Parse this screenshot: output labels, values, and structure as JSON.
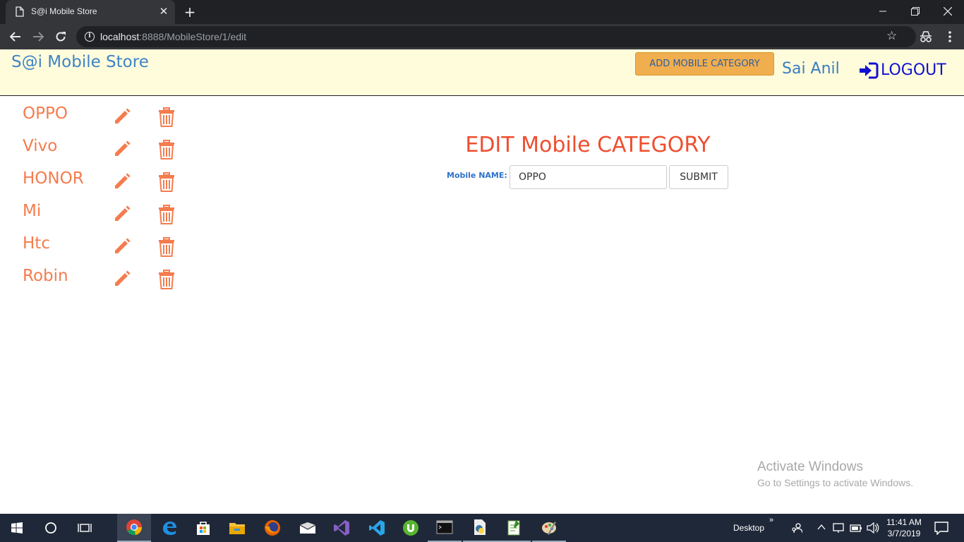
{
  "browser": {
    "tab_title": "S@i Mobile Store",
    "tab_close": "✕",
    "new_tab": "+",
    "url_host": "localhost",
    "url_rest": ":8888/MobileStore/1/edit"
  },
  "header": {
    "brand": "S@i Mobile Store",
    "add_button": "ADD MOBILE CATEGORY",
    "user_name": "Sai Anil",
    "logout_label": "LOGOUT"
  },
  "categories": [
    {
      "name": "OPPO"
    },
    {
      "name": "Vivo"
    },
    {
      "name": "HONOR"
    },
    {
      "name": "Mi"
    },
    {
      "name": "Htc"
    },
    {
      "name": "Robin"
    }
  ],
  "edit_form": {
    "title": "EDIT Mobile CATEGORY",
    "label": "Mobile NAME:",
    "value": "OPPO",
    "submit": "SUBMIT"
  },
  "watermark": {
    "title": "Activate Windows",
    "subtitle": "Go to Settings to activate Windows."
  },
  "taskbar": {
    "desktop_label": "Desktop",
    "time": "11:41 AM",
    "date": "3/7/2019"
  },
  "colors": {
    "header_bg": "#fffcdc",
    "accent_orange": "#f47c4e",
    "title_red": "#ef4e2f",
    "add_button_bg": "#f1ae4e",
    "brand_blue": "#3f84c6",
    "logout_blue": "#1010d0"
  }
}
